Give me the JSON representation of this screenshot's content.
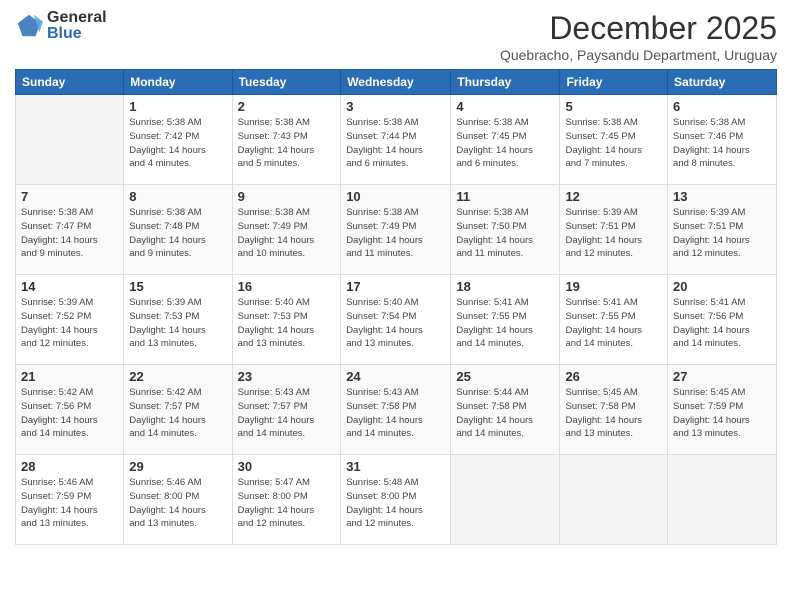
{
  "logo": {
    "general": "General",
    "blue": "Blue"
  },
  "header": {
    "month": "December 2025",
    "location": "Quebracho, Paysandu Department, Uruguay"
  },
  "weekdays": [
    "Sunday",
    "Monday",
    "Tuesday",
    "Wednesday",
    "Thursday",
    "Friday",
    "Saturday"
  ],
  "weeks": [
    [
      {
        "day": "",
        "info": ""
      },
      {
        "day": "1",
        "info": "Sunrise: 5:38 AM\nSunset: 7:42 PM\nDaylight: 14 hours\nand 4 minutes."
      },
      {
        "day": "2",
        "info": "Sunrise: 5:38 AM\nSunset: 7:43 PM\nDaylight: 14 hours\nand 5 minutes."
      },
      {
        "day": "3",
        "info": "Sunrise: 5:38 AM\nSunset: 7:44 PM\nDaylight: 14 hours\nand 6 minutes."
      },
      {
        "day": "4",
        "info": "Sunrise: 5:38 AM\nSunset: 7:45 PM\nDaylight: 14 hours\nand 6 minutes."
      },
      {
        "day": "5",
        "info": "Sunrise: 5:38 AM\nSunset: 7:45 PM\nDaylight: 14 hours\nand 7 minutes."
      },
      {
        "day": "6",
        "info": "Sunrise: 5:38 AM\nSunset: 7:46 PM\nDaylight: 14 hours\nand 8 minutes."
      }
    ],
    [
      {
        "day": "7",
        "info": "Sunrise: 5:38 AM\nSunset: 7:47 PM\nDaylight: 14 hours\nand 9 minutes."
      },
      {
        "day": "8",
        "info": "Sunrise: 5:38 AM\nSunset: 7:48 PM\nDaylight: 14 hours\nand 9 minutes."
      },
      {
        "day": "9",
        "info": "Sunrise: 5:38 AM\nSunset: 7:49 PM\nDaylight: 14 hours\nand 10 minutes."
      },
      {
        "day": "10",
        "info": "Sunrise: 5:38 AM\nSunset: 7:49 PM\nDaylight: 14 hours\nand 11 minutes."
      },
      {
        "day": "11",
        "info": "Sunrise: 5:38 AM\nSunset: 7:50 PM\nDaylight: 14 hours\nand 11 minutes."
      },
      {
        "day": "12",
        "info": "Sunrise: 5:39 AM\nSunset: 7:51 PM\nDaylight: 14 hours\nand 12 minutes."
      },
      {
        "day": "13",
        "info": "Sunrise: 5:39 AM\nSunset: 7:51 PM\nDaylight: 14 hours\nand 12 minutes."
      }
    ],
    [
      {
        "day": "14",
        "info": "Sunrise: 5:39 AM\nSunset: 7:52 PM\nDaylight: 14 hours\nand 12 minutes."
      },
      {
        "day": "15",
        "info": "Sunrise: 5:39 AM\nSunset: 7:53 PM\nDaylight: 14 hours\nand 13 minutes."
      },
      {
        "day": "16",
        "info": "Sunrise: 5:40 AM\nSunset: 7:53 PM\nDaylight: 14 hours\nand 13 minutes."
      },
      {
        "day": "17",
        "info": "Sunrise: 5:40 AM\nSunset: 7:54 PM\nDaylight: 14 hours\nand 13 minutes."
      },
      {
        "day": "18",
        "info": "Sunrise: 5:41 AM\nSunset: 7:55 PM\nDaylight: 14 hours\nand 14 minutes."
      },
      {
        "day": "19",
        "info": "Sunrise: 5:41 AM\nSunset: 7:55 PM\nDaylight: 14 hours\nand 14 minutes."
      },
      {
        "day": "20",
        "info": "Sunrise: 5:41 AM\nSunset: 7:56 PM\nDaylight: 14 hours\nand 14 minutes."
      }
    ],
    [
      {
        "day": "21",
        "info": "Sunrise: 5:42 AM\nSunset: 7:56 PM\nDaylight: 14 hours\nand 14 minutes."
      },
      {
        "day": "22",
        "info": "Sunrise: 5:42 AM\nSunset: 7:57 PM\nDaylight: 14 hours\nand 14 minutes."
      },
      {
        "day": "23",
        "info": "Sunrise: 5:43 AM\nSunset: 7:57 PM\nDaylight: 14 hours\nand 14 minutes."
      },
      {
        "day": "24",
        "info": "Sunrise: 5:43 AM\nSunset: 7:58 PM\nDaylight: 14 hours\nand 14 minutes."
      },
      {
        "day": "25",
        "info": "Sunrise: 5:44 AM\nSunset: 7:58 PM\nDaylight: 14 hours\nand 14 minutes."
      },
      {
        "day": "26",
        "info": "Sunrise: 5:45 AM\nSunset: 7:58 PM\nDaylight: 14 hours\nand 13 minutes."
      },
      {
        "day": "27",
        "info": "Sunrise: 5:45 AM\nSunset: 7:59 PM\nDaylight: 14 hours\nand 13 minutes."
      }
    ],
    [
      {
        "day": "28",
        "info": "Sunrise: 5:46 AM\nSunset: 7:59 PM\nDaylight: 14 hours\nand 13 minutes."
      },
      {
        "day": "29",
        "info": "Sunrise: 5:46 AM\nSunset: 8:00 PM\nDaylight: 14 hours\nand 13 minutes."
      },
      {
        "day": "30",
        "info": "Sunrise: 5:47 AM\nSunset: 8:00 PM\nDaylight: 14 hours\nand 12 minutes."
      },
      {
        "day": "31",
        "info": "Sunrise: 5:48 AM\nSunset: 8:00 PM\nDaylight: 14 hours\nand 12 minutes."
      },
      {
        "day": "",
        "info": ""
      },
      {
        "day": "",
        "info": ""
      },
      {
        "day": "",
        "info": ""
      }
    ]
  ]
}
